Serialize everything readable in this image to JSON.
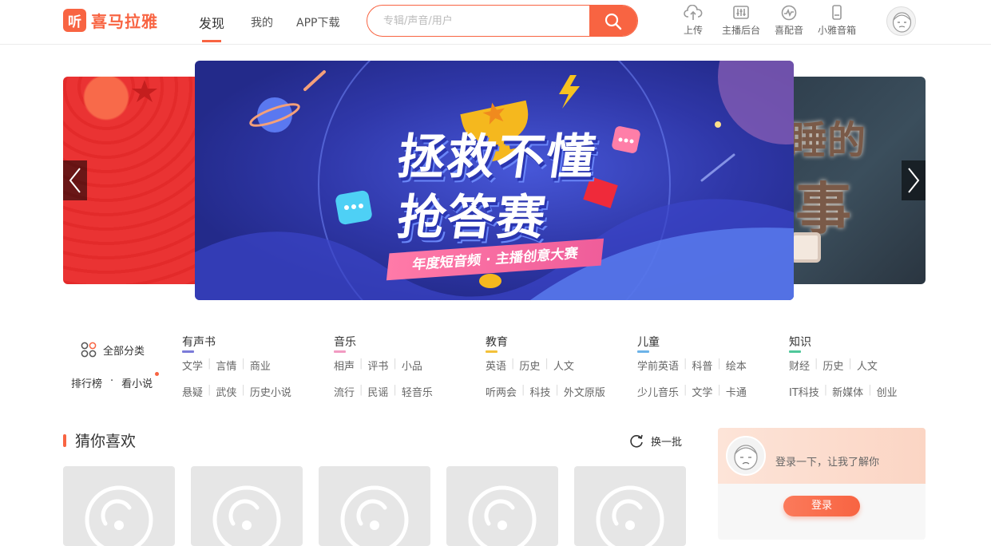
{
  "header": {
    "logo_mark": "听",
    "logo_text": "喜马拉雅",
    "nav": [
      {
        "label": "发现",
        "active": true
      },
      {
        "label": "我的",
        "active": false
      },
      {
        "label": "APP下载",
        "active": false
      }
    ],
    "search_placeholder": "专辑/声音/用户",
    "tools": [
      {
        "label": "上传",
        "icon": "upload-cloud-icon"
      },
      {
        "label": "主播后台",
        "icon": "mixer-icon"
      },
      {
        "label": "喜配音",
        "icon": "waveform-icon"
      },
      {
        "label": "小雅音箱",
        "icon": "speaker-icon"
      }
    ],
    "accent_color": "#f86442"
  },
  "banner": {
    "line1": "拯救不懂",
    "line2": "抢答赛",
    "subtitle": "年度短音频 · 主播创意大赛",
    "right_slide_chars": [
      "睡的",
      "事"
    ]
  },
  "categories": {
    "all_label": "全部分类",
    "side_links": [
      "排行榜",
      "看小说"
    ],
    "side_sep": "·",
    "groups": [
      {
        "title": "有声书",
        "color": "#7b7bd9",
        "rows": [
          [
            "文学",
            "言情",
            "商业"
          ],
          [
            "悬疑",
            "武侠",
            "历史小说"
          ]
        ]
      },
      {
        "title": "音乐",
        "color": "#f29bc2",
        "rows": [
          [
            "相声",
            "评书",
            "小品"
          ],
          [
            "流行",
            "民谣",
            "轻音乐"
          ]
        ]
      },
      {
        "title": "教育",
        "color": "#f3c13a",
        "rows": [
          [
            "英语",
            "历史",
            "人文"
          ],
          [
            "听两会",
            "科技",
            "外文原版"
          ]
        ]
      },
      {
        "title": "儿童",
        "color": "#6cb3e8",
        "rows": [
          [
            "学前英语",
            "科普",
            "绘本"
          ],
          [
            "少儿音乐",
            "文学",
            "卡通"
          ]
        ]
      },
      {
        "title": "知识",
        "color": "#4fc79a",
        "rows": [
          [
            "财经",
            "历史",
            "人文"
          ],
          [
            "IT科技",
            "新媒体",
            "创业"
          ]
        ]
      }
    ]
  },
  "guess": {
    "title": "猜你喜欢",
    "refresh_label": "换一批"
  },
  "login": {
    "prompt": "登录一下，让我了解你",
    "button_label": "登录"
  }
}
